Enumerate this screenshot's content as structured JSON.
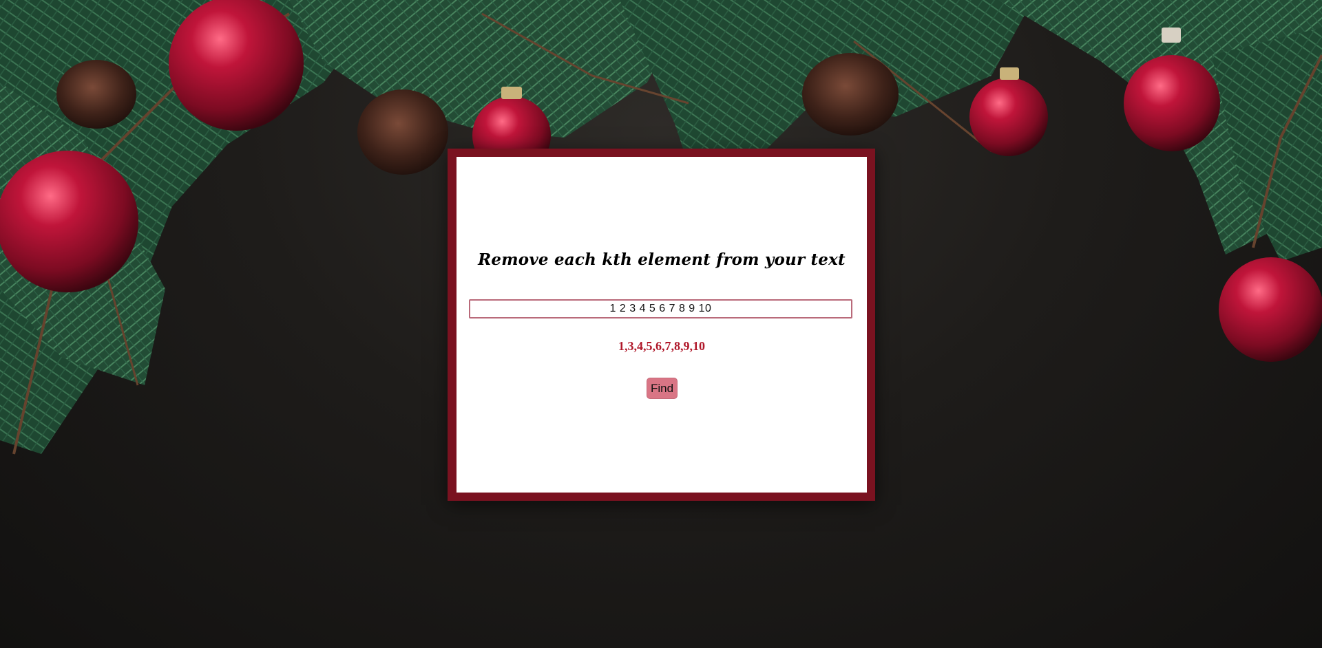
{
  "app": {
    "title": "Remove each kth element from your text",
    "input_value": "1 2 3 4 5 6 7 8 9 10",
    "result": "1,3,4,5,6,7,8,9,10",
    "find_label": "Find"
  },
  "colors": {
    "frame": "#7a1220",
    "card": "#ffffff",
    "result_text": "#b0182a",
    "button": "#d97585",
    "input_border": "#b96a7a",
    "background": "#1e1c1a"
  },
  "icons": [
    "fir-branch-decoration",
    "christmas-ornament-decoration",
    "pine-cone-decoration"
  ]
}
